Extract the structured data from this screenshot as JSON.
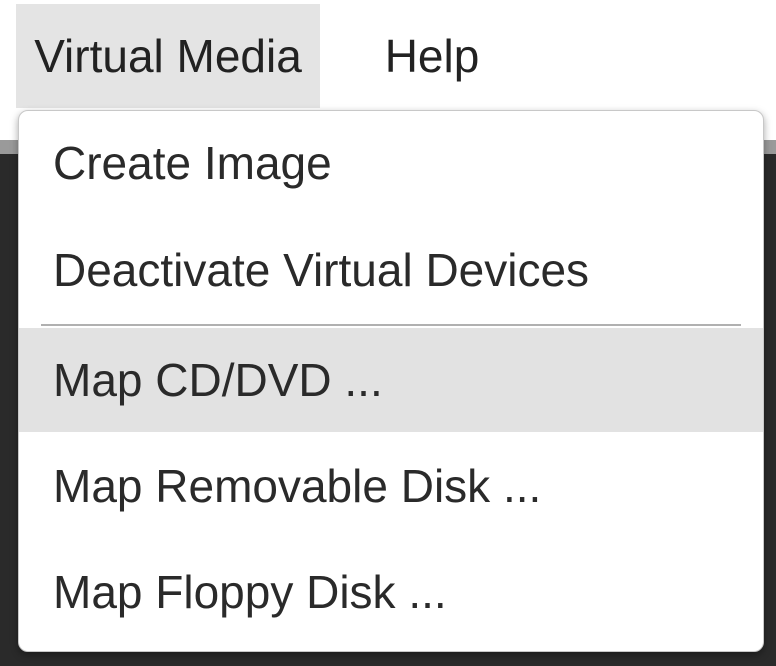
{
  "menubar": {
    "items": [
      {
        "label": "Virtual Media",
        "active": true
      },
      {
        "label": "Help",
        "active": false
      }
    ]
  },
  "dropdown": {
    "items": [
      {
        "label": "Create Image"
      },
      {
        "label": "Deactivate Virtual Devices"
      },
      {
        "label": "Map CD/DVD ...",
        "highlighted": true
      },
      {
        "label": "Map Removable Disk ..."
      },
      {
        "label": "Map Floppy Disk ..."
      }
    ]
  },
  "colors": {
    "menubar_active_bg": "#e4e4e4",
    "dropdown_highlight_bg": "#e2e2e2",
    "text": "#222222",
    "backdrop": "#2a2a2a"
  }
}
